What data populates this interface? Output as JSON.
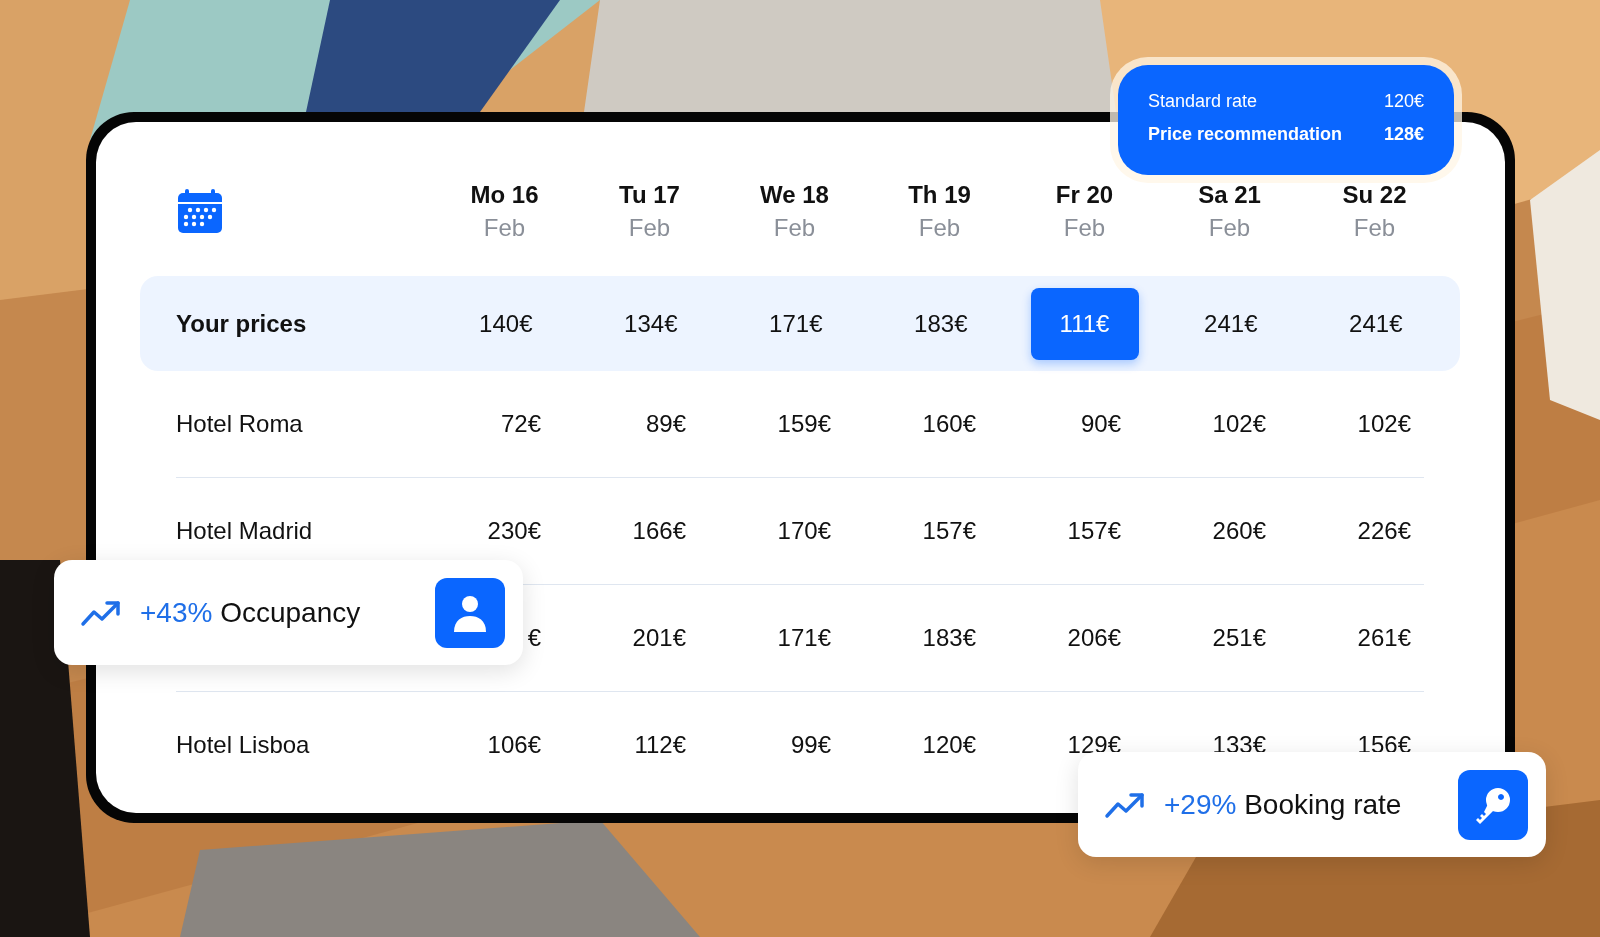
{
  "days": [
    {
      "day": "Mo 16",
      "month": "Feb"
    },
    {
      "day": "Tu 17",
      "month": "Feb"
    },
    {
      "day": "We 18",
      "month": "Feb"
    },
    {
      "day": "Th 19",
      "month": "Feb"
    },
    {
      "day": "Fr 20",
      "month": "Feb"
    },
    {
      "day": "Sa 21",
      "month": "Feb"
    },
    {
      "day": "Su 22",
      "month": "Feb"
    }
  ],
  "your_prices": {
    "label": "Your prices",
    "cells": [
      {
        "value": "140€",
        "selected": false
      },
      {
        "value": "134€",
        "selected": false
      },
      {
        "value": "171€",
        "selected": false
      },
      {
        "value": "183€",
        "selected": false
      },
      {
        "value": "111€",
        "selected": true
      },
      {
        "value": "241€",
        "selected": false
      },
      {
        "value": "241€",
        "selected": false
      }
    ]
  },
  "hotels": [
    {
      "name": "Hotel Roma",
      "prices": [
        "72€",
        "89€",
        "159€",
        "160€",
        "90€",
        "102€",
        "102€"
      ]
    },
    {
      "name": "Hotel Madrid",
      "prices": [
        "230€",
        "166€",
        "170€",
        "157€",
        "157€",
        "260€",
        "226€"
      ]
    },
    {
      "prices": [
        "€",
        "201€",
        "171€",
        "183€",
        "206€",
        "251€",
        "261€"
      ]
    },
    {
      "name": "Hotel Lisboa",
      "prices": [
        "106€",
        "112€",
        "99€",
        "120€",
        "129€",
        "133€",
        "156€"
      ]
    }
  ],
  "rate_card": {
    "rows": [
      {
        "kind": "standard",
        "label": "Standard rate",
        "value": "120€"
      },
      {
        "kind": "recommendation",
        "label": "Price recommendation",
        "value": "128€"
      }
    ]
  },
  "stats": [
    {
      "change": "+43%",
      "label": "Occupancy",
      "kind": "guests"
    },
    {
      "change": "+29%",
      "label": "Booking rate",
      "kind": "bookings"
    }
  ]
}
